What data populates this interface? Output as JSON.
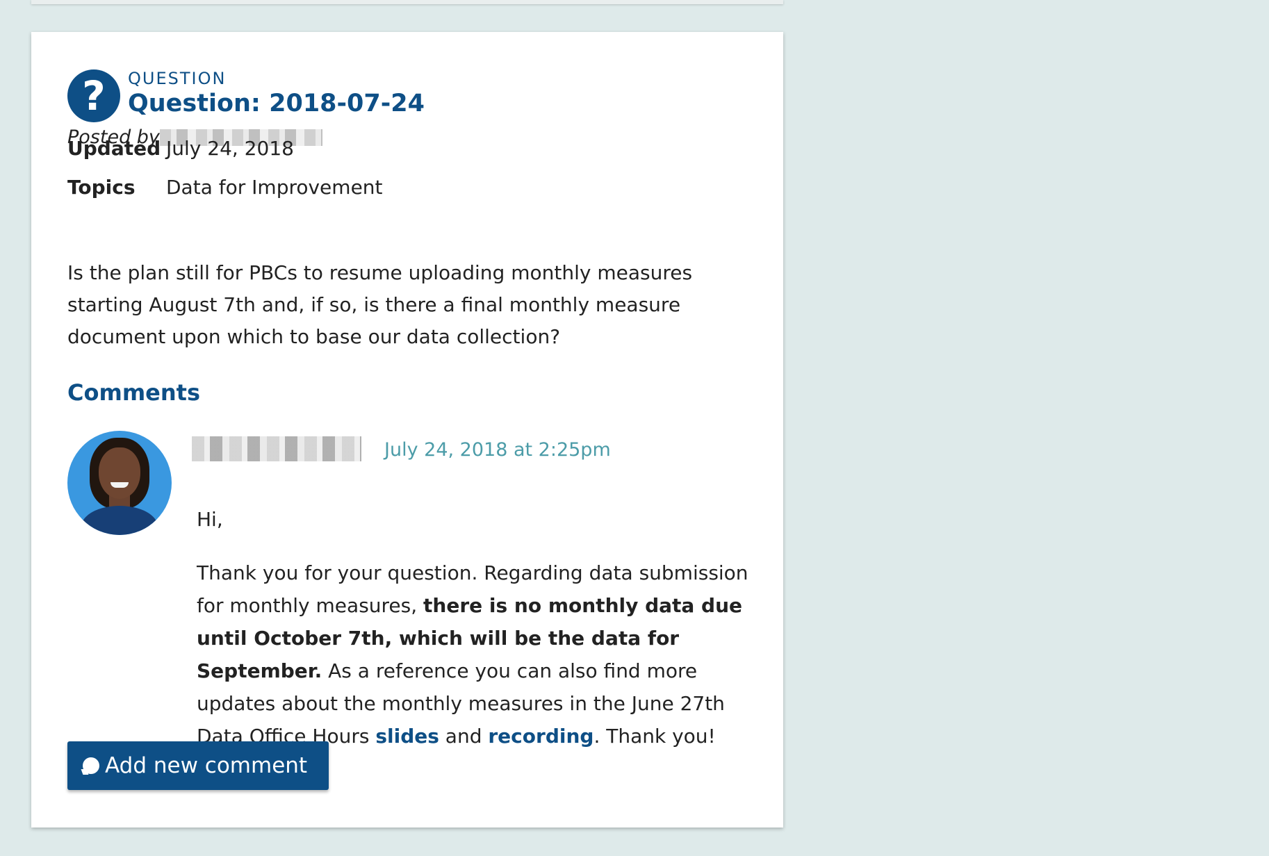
{
  "page": {
    "background_color": "#deeaea",
    "accent_color": "#0e4f86",
    "date_color": "#4c9ca8"
  },
  "question": {
    "icon_glyph": "?",
    "icon_name": "question-icon",
    "eyebrow": "QUESTION",
    "title": "Question: 2018-07-24",
    "posted_by_label": "Posted by",
    "updated_label": "Updated",
    "updated_value": "July 24, 2018",
    "topics_label": "Topics",
    "topics_value": "Data for Improvement",
    "body": "Is the plan still for PBCs to resume uploading monthly measures starting August 7th and, if so, is there a final monthly measure document upon which to base our data collection?"
  },
  "comments": {
    "heading": "Comments",
    "items": [
      {
        "date": "July 24, 2018 at 2:25pm",
        "greeting": "Hi,",
        "text_before_bold": "Thank you for your question. Regarding data submission for monthly measures, ",
        "bold_text": "there is no monthly data due until October 7th, which will be the data for September.",
        "text_after_bold": " As a reference you can also find more updates about the monthly measures in the June 27th Data Office Hours ",
        "link_slides": "slides",
        "link_joiner": " and ",
        "link_recording": "recording",
        "closing": ". Thank you!"
      }
    ]
  },
  "actions": {
    "add_comment_label": "Add new comment",
    "add_comment_icon": "chat-bubble-icon"
  }
}
